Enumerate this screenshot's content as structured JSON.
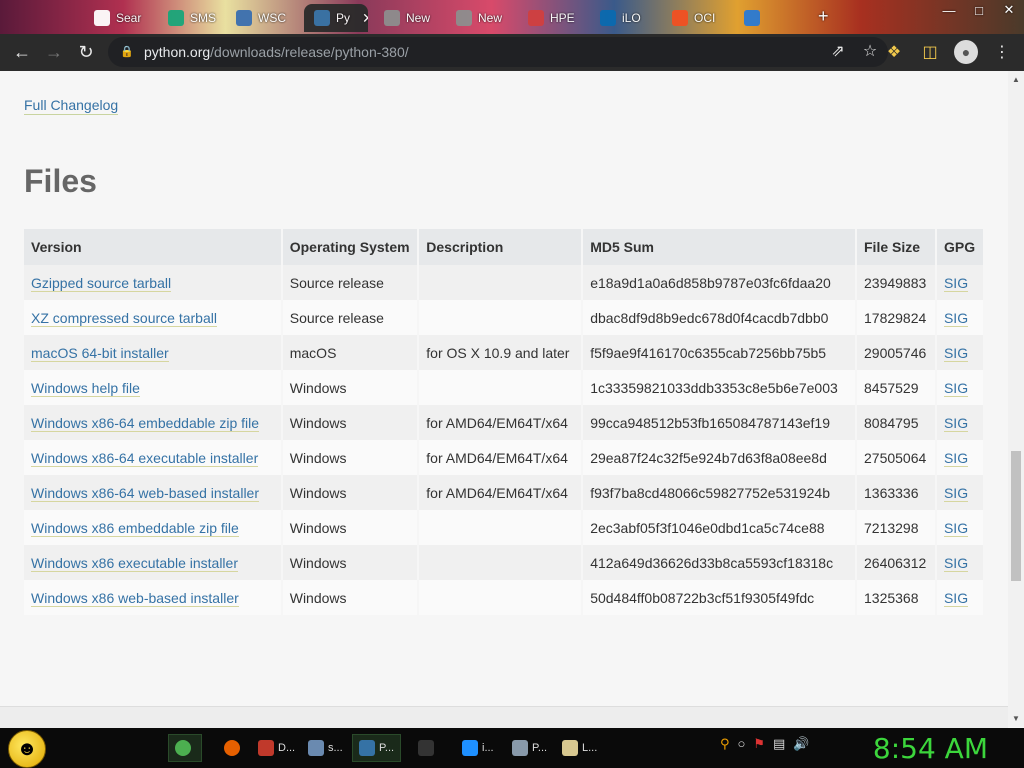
{
  "browser": {
    "tabs": [
      {
        "label": "Sear",
        "color": "#ffffff"
      },
      {
        "label": "SMS",
        "color": "#1aa67a"
      },
      {
        "label": "WSC",
        "color": "#3a6fb0"
      },
      {
        "label": "Py",
        "color": "#3572a5",
        "active": true
      },
      {
        "label": "New",
        "color": "#8e8e8e"
      },
      {
        "label": "New",
        "color": "#8e8e8e"
      },
      {
        "label": "HPE",
        "color": "#d04040"
      },
      {
        "label": "iLO",
        "color": "#0a6ab0"
      },
      {
        "label": "OCI",
        "color": "#f25022"
      },
      {
        "label": "",
        "color": "#2a7ad4"
      }
    ],
    "url_domain": "python.org",
    "url_path": "/downloads/release/python-380/"
  },
  "page": {
    "changelog_link": "Full Changelog",
    "section_title": "Files",
    "table": {
      "headers": [
        "Version",
        "Operating System",
        "Description",
        "MD5 Sum",
        "File Size",
        "GPG"
      ],
      "rows": [
        {
          "version": "Gzipped source tarball",
          "os": "Source release",
          "desc": "",
          "md5": "e18a9d1a0a6d858b9787e03fc6fdaa20",
          "size": "23949883",
          "gpg": "SIG"
        },
        {
          "version": "XZ compressed source tarball",
          "os": "Source release",
          "desc": "",
          "md5": "dbac8df9d8b9edc678d0f4cacdb7dbb0",
          "size": "17829824",
          "gpg": "SIG"
        },
        {
          "version": "macOS 64-bit installer",
          "os": "macOS",
          "desc": "for OS X 10.9 and later",
          "md5": "f5f9ae9f416170c6355cab7256bb75b5",
          "size": "29005746",
          "gpg": "SIG"
        },
        {
          "version": "Windows help file",
          "os": "Windows",
          "desc": "",
          "md5": "1c33359821033ddb3353c8e5b6e7e003",
          "size": "8457529",
          "gpg": "SIG"
        },
        {
          "version": "Windows x86-64 embeddable zip file",
          "os": "Windows",
          "desc": "for AMD64/EM64T/x64",
          "md5": "99cca948512b53fb165084787143ef19",
          "size": "8084795",
          "gpg": "SIG"
        },
        {
          "version": "Windows x86-64 executable installer",
          "os": "Windows",
          "desc": "for AMD64/EM64T/x64",
          "md5": "29ea87f24c32f5e924b7d63f8a08ee8d",
          "size": "27505064",
          "gpg": "SIG"
        },
        {
          "version": "Windows x86-64 web-based installer",
          "os": "Windows",
          "desc": "for AMD64/EM64T/x64",
          "md5": "f93f7ba8cd48066c59827752e531924b",
          "size": "1363336",
          "gpg": "SIG"
        },
        {
          "version": "Windows x86 embeddable zip file",
          "os": "Windows",
          "desc": "",
          "md5": "2ec3abf05f3f1046e0dbd1ca5c74ce88",
          "size": "7213298",
          "gpg": "SIG"
        },
        {
          "version": "Windows x86 executable installer",
          "os": "Windows",
          "desc": "",
          "md5": "412a649d36626d33b8ca5593cf18318c",
          "size": "26406312",
          "gpg": "SIG"
        },
        {
          "version": "Windows x86 web-based installer",
          "os": "Windows",
          "desc": "",
          "md5": "50d484ff0b08722b3cf51f9305f49fdc",
          "size": "1325368",
          "gpg": "SIG"
        }
      ]
    }
  },
  "taskbar": {
    "items": [
      {
        "label": "",
        "icon": "chrome-icon",
        "color": "#4caf50",
        "running": true
      },
      {
        "label": "",
        "icon": "firefox-icon",
        "color": "#e66000"
      },
      {
        "label": "D...",
        "icon": "document-icon",
        "color": "#c0392b"
      },
      {
        "label": "s...",
        "icon": "window-icon",
        "color": "#6a8ab0"
      },
      {
        "label": "P...",
        "icon": "python-icon",
        "color": "#3572a5",
        "running": true
      },
      {
        "label": "",
        "icon": "terminal-icon",
        "color": "#333333"
      },
      {
        "label": "i...",
        "icon": "ie-icon",
        "color": "#1e90ff"
      },
      {
        "label": "P...",
        "icon": "remote-desktop-icon",
        "color": "#8899aa"
      },
      {
        "label": "L...",
        "icon": "notepad-icon",
        "color": "#d8c890"
      }
    ],
    "clock": "8:54 AM"
  }
}
